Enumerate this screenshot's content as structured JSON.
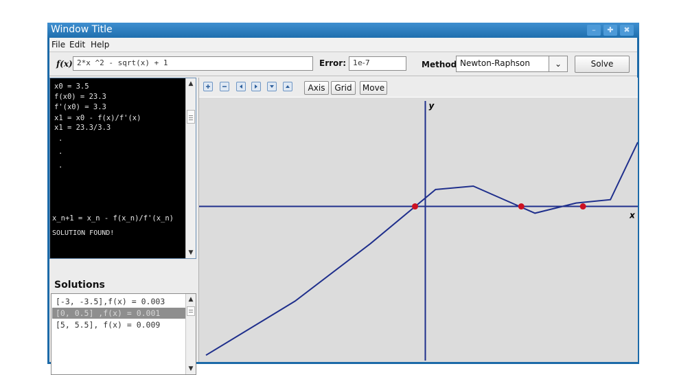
{
  "window": {
    "title": "Window Title",
    "buttons": [
      "minimize",
      "maximize",
      "close"
    ]
  },
  "menu": [
    "File",
    "Edit",
    "Help"
  ],
  "toolbar": {
    "function_label": "f(x)",
    "function_value": "2*x ^2 - sqrt(x) + 1",
    "error_label": "Error:",
    "error_value": "1e-7",
    "method_label": "Method:",
    "method_value": "Newton-Raphson",
    "solve_label": "Solve"
  },
  "console": {
    "lines": [
      "x0 = 3.5",
      "f(x0) = 23.3",
      "f'(x0) = 3.3",
      "x1 = x0 - f(x)/f'(x)",
      "x1 = 23.3/3.3",
      ".",
      ".",
      "."
    ],
    "formula": "x_n+1 = x_n - f(x_n)/f'(x_n)",
    "status": "SOLUTION FOUND!"
  },
  "solutions": {
    "title": "Solutions",
    "items": [
      {
        "text": "[-3, -3.5],f(x) = 0.003",
        "selected": false
      },
      {
        "text": "[0, 0.5] ,f(x) = 0.001",
        "selected": true
      },
      {
        "text": "[5, 5.5], f(x) = 0.009",
        "selected": false
      }
    ]
  },
  "plot": {
    "nav_icons": [
      "zoom-in-icon",
      "zoom-out-icon",
      "pan-left-icon",
      "pan-right-icon",
      "pan-down-icon",
      "pan-up-icon"
    ],
    "buttons": {
      "axis": "Axis",
      "grid": "Grid",
      "move": "Move"
    },
    "x_axis_label": "x",
    "y_axis_label": "y",
    "colors": {
      "curve": "#1f2f8c",
      "axes": "#1f2f8c",
      "roots": "#cc1122",
      "background": "#dcdcdc"
    }
  },
  "chart_data": {
    "type": "line",
    "xlabel": "x",
    "ylabel": "y",
    "xlim": [
      -3.3,
      3.1
    ],
    "ylim": [
      -2.3,
      1.6
    ],
    "series": [
      {
        "x": [
          -3.2,
          -1.9,
          -0.8,
          0.15,
          0.7,
          1.6,
          2.2,
          2.7,
          3.1
        ],
        "y": [
          -2.2,
          -1.4,
          -0.55,
          0.25,
          0.3,
          -0.1,
          0.05,
          0.1,
          0.95
        ]
      }
    ],
    "roots": [
      -0.15,
      1.4,
      2.3
    ]
  }
}
